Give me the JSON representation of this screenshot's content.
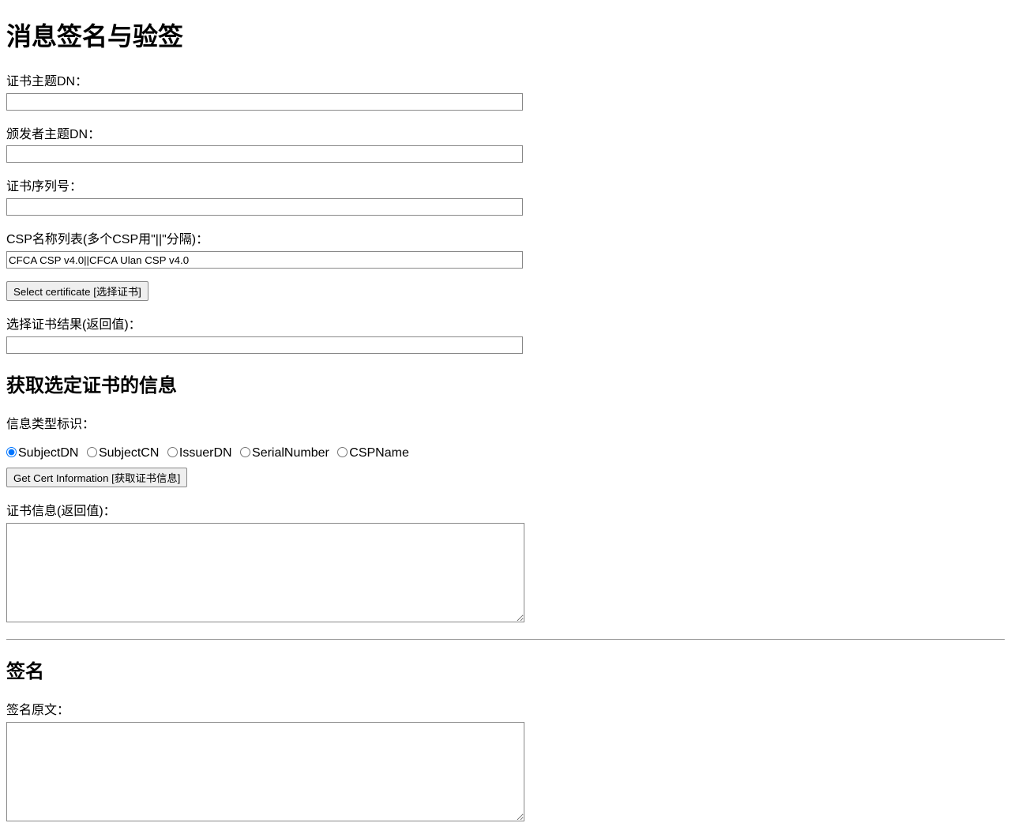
{
  "title": "消息签名与验签",
  "labels": {
    "subjectDN": "证书主题DN：",
    "issuerDN": "颁发者主题DN：",
    "serialNumber": "证书序列号：",
    "cspList": "CSP名称列表(多个CSP用\"||\"分隔)：",
    "selectCertResult": "选择证书结果(返回值)：",
    "infoTypeId": "信息类型标识：",
    "certInfoResult": "证书信息(返回值)：",
    "signSource": "签名原文："
  },
  "values": {
    "subjectDN": "",
    "issuerDN": "",
    "serialNumber": "",
    "cspList": "CFCA CSP v4.0||CFCA Ulan CSP v4.0",
    "selectCertResult": "",
    "certInfoResult": "",
    "signSource": ""
  },
  "buttons": {
    "selectCert": "Select certificate [选择证书]",
    "getCertInfo": "Get Cert Information [获取证书信息]"
  },
  "sections": {
    "getCertInfo": "获取选定证书的信息",
    "sign": "签名"
  },
  "radios": {
    "subjectDN": "SubjectDN",
    "subjectCN": "SubjectCN",
    "issuerDN": "IssuerDN",
    "serialNumber": "SerialNumber",
    "cspName": "CSPName"
  }
}
